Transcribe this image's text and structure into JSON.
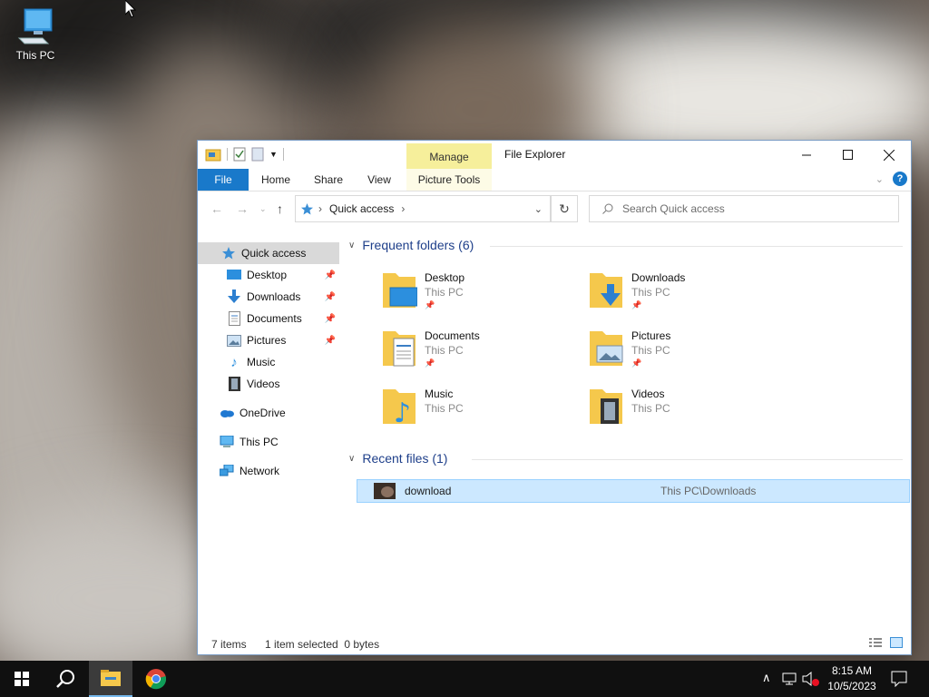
{
  "desktop": {
    "icons": [
      {
        "label": "This PC"
      }
    ]
  },
  "window": {
    "title": "File Explorer",
    "manage_tab": "Manage",
    "ribbon": {
      "tabs": [
        "File",
        "Home",
        "Share",
        "View"
      ],
      "contextual_tab": "Picture Tools"
    },
    "address": {
      "path": "Quick access"
    },
    "search": {
      "placeholder": "Search Quick access"
    },
    "nav": {
      "quick_access": "Quick access",
      "pinned": [
        {
          "label": "Desktop",
          "pinned": true
        },
        {
          "label": "Downloads",
          "pinned": true
        },
        {
          "label": "Documents",
          "pinned": true
        },
        {
          "label": "Pictures",
          "pinned": true
        },
        {
          "label": "Music",
          "pinned": false
        },
        {
          "label": "Videos",
          "pinned": false
        }
      ],
      "onedrive": "OneDrive",
      "this_pc": "This PC",
      "network": "Network"
    },
    "frequent": {
      "header": "Frequent folders (6)",
      "folders": [
        {
          "name": "Desktop",
          "location": "This PC",
          "pinned": true
        },
        {
          "name": "Downloads",
          "location": "This PC",
          "pinned": true
        },
        {
          "name": "Documents",
          "location": "This PC",
          "pinned": true
        },
        {
          "name": "Pictures",
          "location": "This PC",
          "pinned": true
        },
        {
          "name": "Music",
          "location": "This PC",
          "pinned": false
        },
        {
          "name": "Videos",
          "location": "This PC",
          "pinned": false
        }
      ]
    },
    "recent": {
      "header": "Recent files (1)",
      "files": [
        {
          "name": "download",
          "path": "This PC\\Downloads"
        }
      ]
    },
    "status": {
      "items": "7 items",
      "selection": "1 item selected  0 bytes"
    }
  },
  "taskbar": {
    "clock": {
      "time": "8:15 AM",
      "date": "10/5/2023"
    }
  },
  "colors": {
    "accent": "#1979ca",
    "manage_highlight": "#f6ef9b",
    "selection": "#cce8ff",
    "group_header": "#1e3f8a"
  }
}
